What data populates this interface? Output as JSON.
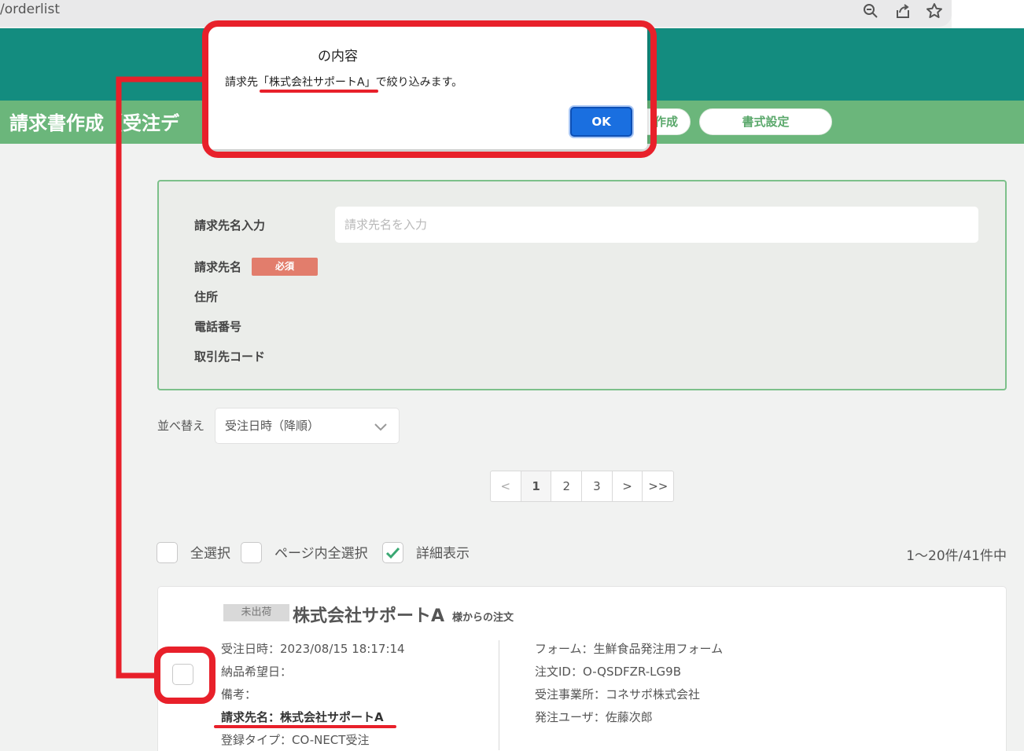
{
  "browser": {
    "url": "/orderlist",
    "icons": [
      "zoom-icon",
      "share-icon",
      "star-icon"
    ]
  },
  "header": {
    "title": "請求書作成（受注デ",
    "buttons": [
      {
        "label": "作成"
      },
      {
        "label": "書式設定"
      }
    ]
  },
  "form": {
    "name_input_label": "請求先名入力",
    "name_input_placeholder": "請求先名を入力",
    "name_label": "請求先名",
    "required_badge": "必須",
    "address_label": "住所",
    "phone_label": "電話番号",
    "client_code_label": "取引先コード"
  },
  "sort": {
    "label": "並べ替え",
    "selected": "受注日時（降順）"
  },
  "pagination": {
    "items": [
      "<",
      "1",
      "2",
      "3",
      ">",
      ">>"
    ],
    "current": "1"
  },
  "selection": {
    "select_all": "全選択",
    "select_page": "ページ内全選択",
    "detail_view": "詳細表示",
    "detail_checked": true,
    "count": "1〜20件/41件中"
  },
  "order": {
    "status_badge": "未出荷",
    "customer": "株式会社サポートA",
    "customer_suffix": "様からの注文",
    "order_datetime": "受注日時：2023/08/15 18:17:14",
    "delivery_date": "納品希望日：",
    "note": "備考：",
    "billing_name": "請求先名：株式会社サポートA",
    "registration_type": "登録タイプ：CO-NECT受注",
    "form": "フォーム：生鮮食品発注用フォーム",
    "order_id": "注文ID：O-QSDFZR-LG9B",
    "office": "受注事業所：コネサポ株式会社",
    "ordering_user": "発注ユーザ：佐藤次郎"
  },
  "dialog": {
    "title": "の内容",
    "message": "請求先「株式会社サポートA」で絞り込みます。",
    "ok_label": "OK"
  },
  "colors": {
    "teal": "#138c7f",
    "green": "#6bb67b",
    "annotation_red": "#e8202a",
    "ok_blue": "#1a6fe0"
  }
}
